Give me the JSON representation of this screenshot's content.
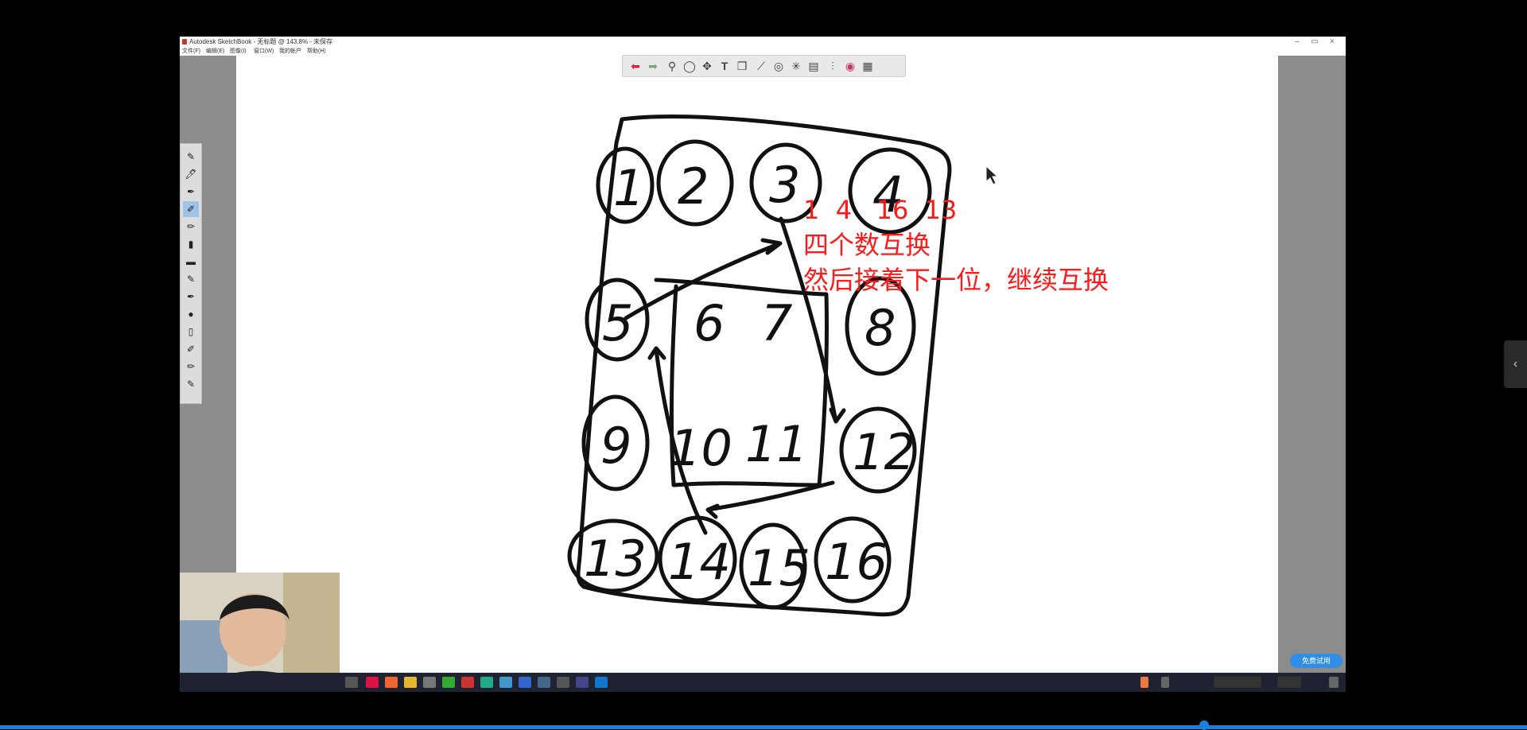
{
  "window": {
    "title": "Autodesk SketchBook - 无标题 @ 143.8% - 未保存",
    "minimize": "–",
    "maximize": "▭",
    "close": "×"
  },
  "menu": {
    "items": [
      "文件(F)",
      "编辑(E)",
      "图像(I)",
      "窗口(W)",
      "我的帐户",
      "帮助(H)"
    ]
  },
  "toolbar": {
    "icons": [
      "undo-icon",
      "redo-icon",
      "zoom-icon",
      "lasso-icon",
      "move-icon",
      "text-icon",
      "copy-icon",
      "ruler-icon",
      "ellipse-guide-icon",
      "symmetry-icon",
      "layer-icon",
      "brush-palette-icon",
      "color-wheel-icon",
      "swatch-icon"
    ]
  },
  "canvas": {
    "numbers": [
      "1",
      "2",
      "3",
      "4",
      "5",
      "6",
      "7",
      "8",
      "9",
      "10",
      "11",
      "12",
      "13",
      "14",
      "15",
      "16"
    ],
    "annotation": {
      "line1": "1  4   16  13",
      "line2": "四个数互换",
      "line3": "然后接着下一位，继续互换"
    }
  },
  "trial_button": "免费试用",
  "side_handle": "‹",
  "colors": {
    "annotation": "#ff1a1a",
    "ink": "#111111",
    "taskbar": "#1f2230",
    "progress": "#1b7fe0"
  }
}
